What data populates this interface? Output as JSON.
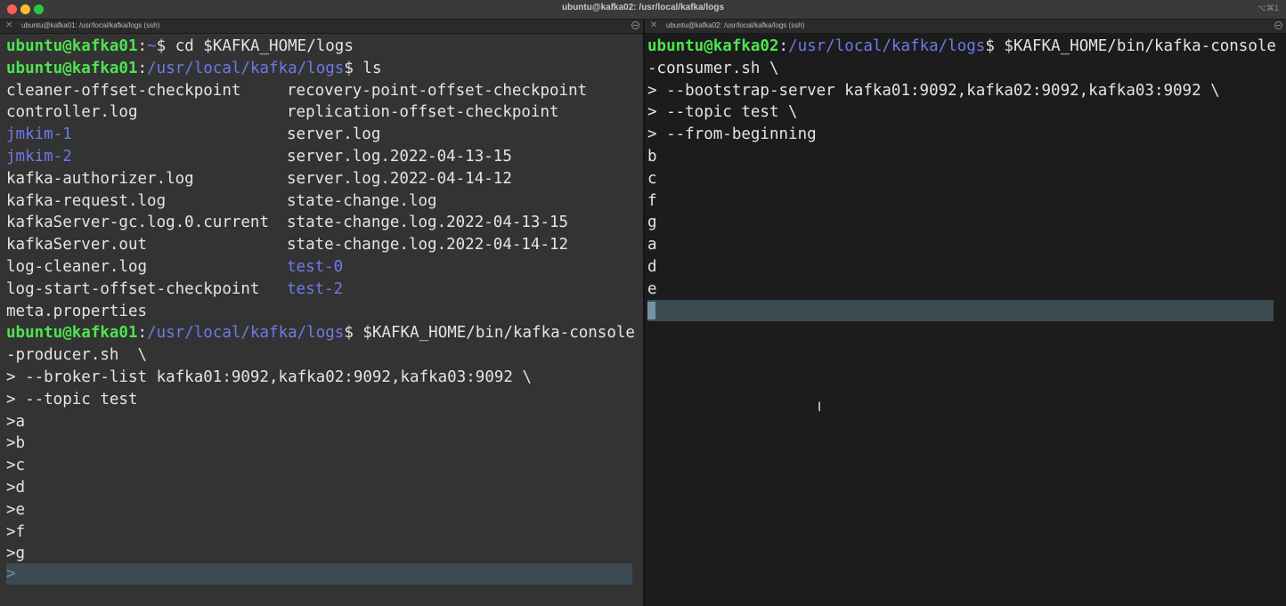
{
  "window": {
    "title": "ubuntu@kafka02: /usr/local/kafka/logs",
    "shortcut": "⌥⌘1"
  },
  "tabs": [
    {
      "title": "ubuntu@kafka01: /usr/local/kafka/logs (ssh)"
    },
    {
      "title": "ubuntu@kafka02: /usr/local/kafka/logs (ssh)"
    }
  ],
  "left": {
    "p1": {
      "user": "ubuntu@kafka01",
      "path": "~",
      "cmd": "cd $KAFKA_HOME/logs"
    },
    "p2": {
      "user": "ubuntu@kafka01",
      "path": "/usr/local/kafka/logs",
      "cmd": "ls"
    },
    "ls": [
      [
        "cleaner-offset-checkpoint",
        "recovery-point-offset-checkpoint"
      ],
      [
        "controller.log",
        "replication-offset-checkpoint"
      ],
      [
        "jmkim-1",
        "server.log"
      ],
      [
        "jmkim-2",
        "server.log.2022-04-13-15"
      ],
      [
        "kafka-authorizer.log",
        "server.log.2022-04-14-12"
      ],
      [
        "kafka-request.log",
        "state-change.log"
      ],
      [
        "kafkaServer-gc.log.0.current",
        "state-change.log.2022-04-13-15"
      ],
      [
        "kafkaServer.out",
        "state-change.log.2022-04-14-12"
      ],
      [
        "log-cleaner.log",
        "test-0"
      ],
      [
        "log-start-offset-checkpoint",
        "test-2"
      ],
      [
        "meta.properties",
        ""
      ]
    ],
    "p3": {
      "user": "ubuntu@kafka01",
      "path": "/usr/local/kafka/logs",
      "cmd": "$KAFKA_HOME/bin/kafka-console"
    },
    "cont": [
      "-producer.sh  \\",
      "> --broker-list kafka01:9092,kafka02:9092,kafka03:9092 \\",
      "> --topic test"
    ],
    "inputs": [
      ">a",
      ">b",
      ">c",
      ">d",
      ">e",
      ">f",
      ">g"
    ],
    "cursor": ">"
  },
  "right": {
    "p1": {
      "user": "ubuntu@kafka02",
      "path": "/usr/local/kafka/logs",
      "cmd": "$KAFKA_HOME/bin/kafka-console"
    },
    "cont": [
      "-consumer.sh \\",
      "> --bootstrap-server kafka01:9092,kafka02:9092,kafka03:9092 \\",
      "> --topic test \\",
      "> --from-beginning"
    ],
    "output": [
      "b",
      "c",
      "f",
      "g",
      "a",
      "d",
      "e"
    ]
  }
}
